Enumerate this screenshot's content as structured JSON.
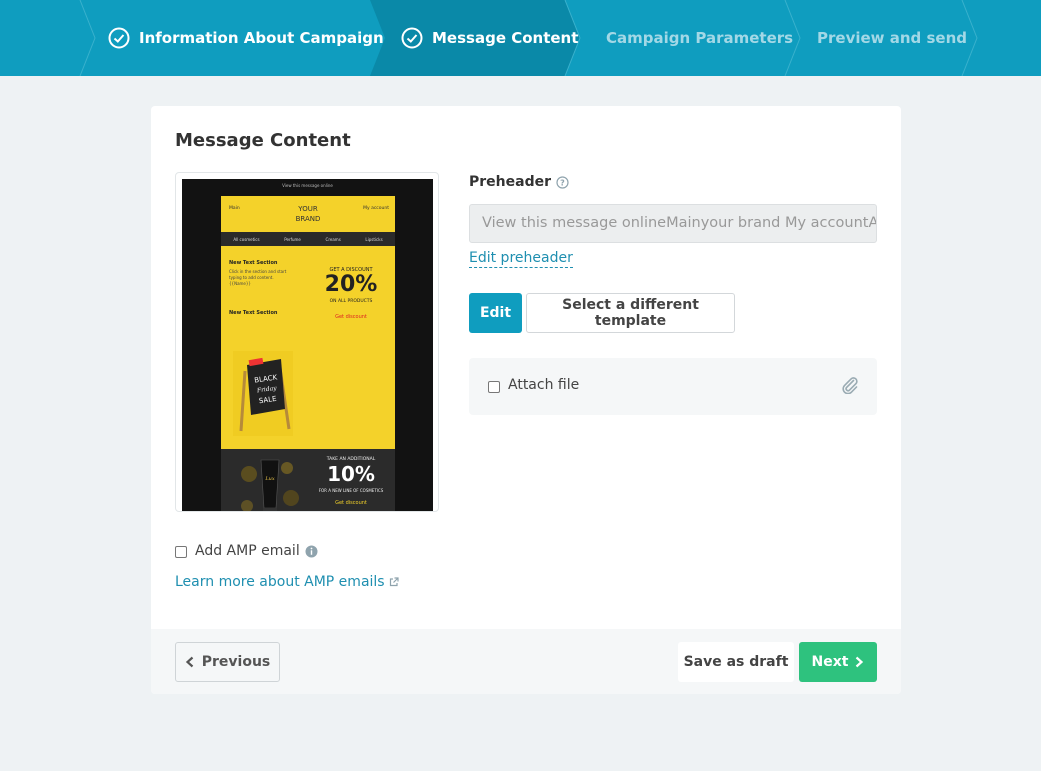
{
  "stepper": {
    "steps": [
      {
        "label": "Information About Campaign",
        "status": "done"
      },
      {
        "label": "Message Content",
        "status": "current"
      },
      {
        "label": "Campaign Parameters",
        "status": "pending"
      },
      {
        "label": "Preview and send",
        "status": "pending"
      }
    ]
  },
  "card": {
    "title": "Message Content"
  },
  "preview": {
    "top_text": "View this message online",
    "main": "Main",
    "brand_line1": "YOUR",
    "brand_line2": "BRAND",
    "account": "My account",
    "nav": [
      "All cosmetics",
      "Perfume",
      "Creams",
      "Lipsticks"
    ],
    "section1": "New Text Section",
    "small_text": "Click in the section and start typing to add content. {{Name}}",
    "get_discount": "GET A DISCOUNT",
    "percent1": "20%",
    "on_all": "ON ALL PRODUCTS",
    "link1": "Get discount",
    "section2": "New Text Section",
    "sign_text": "BLACK Friday SALE",
    "take": "TAKE AN ADDITIONAL",
    "percent2": "10%",
    "line_text": "FOR A NEW LINE OF COSMETICS",
    "link2": "Get discount"
  },
  "preheader": {
    "label": "Preheader",
    "value": "View this message onlineMainyour brand My accountAll cosmetics",
    "edit_link": "Edit preheader"
  },
  "buttons": {
    "edit": "Edit",
    "select_template": "Select a different template",
    "previous": "Previous",
    "save_draft": "Save as draft",
    "next": "Next"
  },
  "attach": {
    "label": "Attach file",
    "checked": false
  },
  "amp": {
    "label": "Add AMP email",
    "checked": false,
    "learn_more": "Learn more about AMP emails"
  },
  "colors": {
    "header": "#0f9dbf",
    "accent": "#1f8fb0",
    "next": "#2ec27e"
  }
}
